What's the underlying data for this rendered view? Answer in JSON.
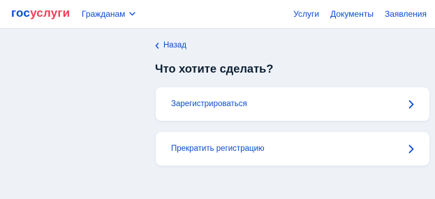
{
  "header": {
    "logo": {
      "part1": "гос",
      "part2": "услуги"
    },
    "audience_label": "Гражданам",
    "audience_icon": "chevron-down-icon",
    "nav": [
      "Услуги",
      "Документы",
      "Заявления"
    ]
  },
  "main": {
    "back_label": "Назад",
    "back_icon": "chevron-left-icon",
    "title": "Что хотите сделать?",
    "options": [
      {
        "label": "Зарегистрироваться",
        "icon": "chevron-right-icon"
      },
      {
        "label": "Прекратить регистрацию",
        "icon": "chevron-right-icon"
      }
    ]
  },
  "colors": {
    "brand_blue": "#0d4cd3",
    "brand_red": "#ee3f58",
    "text_dark": "#0b1f33",
    "background": "#eef2f7",
    "card": "#ffffff"
  }
}
